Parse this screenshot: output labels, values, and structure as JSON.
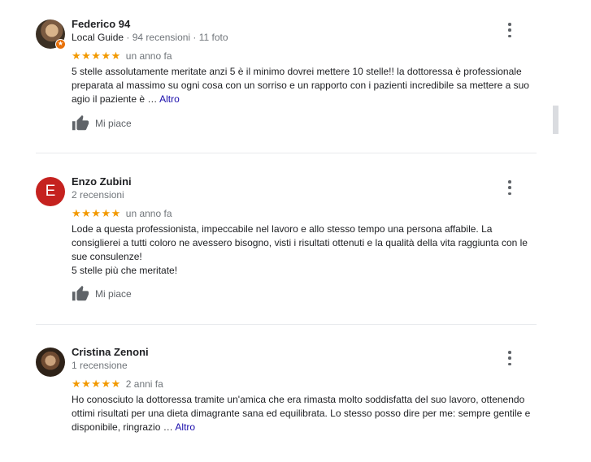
{
  "reviews": [
    {
      "name": "Federico 94",
      "guide_label": "Local Guide",
      "meta": " · 94 recensioni · 11 foto",
      "stars": "★★★★★",
      "rating": 5,
      "date": "un anno fa",
      "text": "5 stelle assolutamente meritate anzi 5 è il minimo dovrei mettere 10 stelle!! la dottoressa è professionale preparata al massimo su ogni cosa con un sorriso e un rapporto con i pazienti incredibile sa mettere a suo agio il paziente è … ",
      "more": "Altro",
      "like": "Mi piace",
      "avatar_icon": "user-photo"
    },
    {
      "name": "Enzo Zubini",
      "meta": "2 recensioni",
      "avatar_letter": "E",
      "stars": "★★★★★",
      "rating": 5,
      "date": "un anno fa",
      "text": "Lode a questa professionista, impeccabile nel lavoro e allo stesso tempo una persona affabile. La consiglierei a tutti coloro ne avessero bisogno, visti i risultati ottenuti e la qualità della vita raggiunta con le sue consulenze!",
      "text2": "5 stelle più che meritate!",
      "like": "Mi piace"
    },
    {
      "name": "Cristina Zenoni",
      "meta": "1 recensione",
      "stars": "★★★★★",
      "rating": 5,
      "date": "2 anni fa",
      "text": "Ho conosciuto la dottoressa tramite un'amica che era rimasta molto soddisfatta del suo lavoro, ottenendo ottimi risultati per una dieta dimagrante sana ed equilibrata. Lo stesso posso dire per me: sempre gentile e disponibile, ringrazio … ",
      "more": "Altro",
      "avatar_icon": "user-photo"
    }
  ],
  "colors": {
    "stars": "#f29900",
    "link": "#1a0dab",
    "avatar_letter_bg": "#c5221f",
    "guide_badge": "#e8710a"
  },
  "icons": {
    "menu": "more-vert-icon",
    "like": "thumb-up-icon",
    "guide": "local-guide-badge-icon"
  }
}
